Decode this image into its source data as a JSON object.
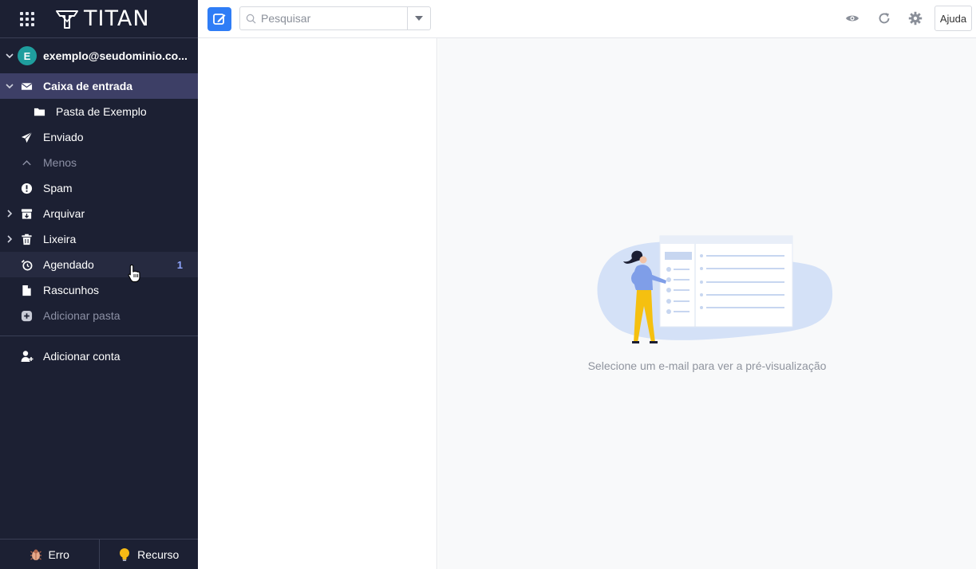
{
  "app": {
    "brand": "TITAN"
  },
  "account": {
    "initial": "E",
    "email": "exemplo@seudominio.co..."
  },
  "folders": [
    {
      "label": "Caixa de entrada",
      "icon": "envelope-icon"
    },
    {
      "label": "Pasta de Exemplo",
      "icon": "folder-icon"
    },
    {
      "label": "Enviado",
      "icon": "paper-plane-icon"
    },
    {
      "label": "Menos",
      "icon": "chevron-up-icon"
    },
    {
      "label": "Spam",
      "icon": "alert-circle-icon"
    },
    {
      "label": "Arquivar",
      "icon": "archive-icon"
    },
    {
      "label": "Lixeira",
      "icon": "trash-icon"
    },
    {
      "label": "Agendado",
      "icon": "alarm-clock-icon",
      "count": "1"
    },
    {
      "label": "Rascunhos",
      "icon": "draft-icon"
    },
    {
      "label": "Adicionar pasta",
      "icon": "plus-circle-icon"
    }
  ],
  "add_account": {
    "label": "Adicionar conta",
    "icon": "user-plus-icon"
  },
  "footer": {
    "bug_label": "Erro",
    "idea_label": "Recurso"
  },
  "toolbar": {
    "search_placeholder": "Pesquisar",
    "help_label": "Ajuda"
  },
  "preview": {
    "empty_message": "Selecione um e-mail para ver a pré-visualização"
  },
  "colors": {
    "sidebar_bg": "#1c2033",
    "active_folder_bg": "#3d3f66",
    "accent": "#2f7df6",
    "count": "#8fa5ff"
  }
}
